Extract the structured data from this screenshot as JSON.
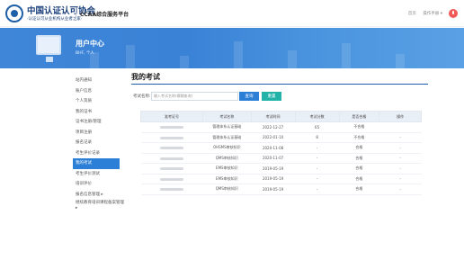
{
  "header": {
    "org_name": "中国认证认可协会",
    "org_subtitle": "·认证认可从业机构从业者之家·",
    "platform_title": "CCAA综合服务平台",
    "links": [
      "首页",
      "操作手册 ▾"
    ]
  },
  "banner": {
    "title": "用户中心",
    "user_line": "BHF, 个人"
  },
  "sidebar": {
    "items": [
      {
        "label": "站内通知"
      },
      {
        "label": "账户信息"
      },
      {
        "label": "个人资质"
      },
      {
        "label": "我的证书"
      },
      {
        "label": "证书注册/管理"
      },
      {
        "label": "项目注册"
      },
      {
        "label": "报名记录"
      },
      {
        "label": "考生评价记录"
      },
      {
        "label": "我的考试",
        "active": true
      },
      {
        "label": "考生评价测试"
      },
      {
        "label": "培训评价"
      },
      {
        "label": "报名信息管理 ▸"
      },
      {
        "label": "继续教育培训课程备案管理 ▸"
      }
    ]
  },
  "main": {
    "title": "我的考试",
    "search_label": "考试名称:",
    "search_placeholder": "输入考试名称(模糊查询)",
    "query_btn": "查询",
    "reset_btn": "重置",
    "columns": [
      "准考证号",
      "考试名称",
      "考试时间",
      "考试分数",
      "是否合格",
      "操作"
    ],
    "rows": [
      {
        "name": "管理体系认证基础",
        "time": "2022-12-27",
        "score": "65",
        "pass": "不合格",
        "op": ""
      },
      {
        "name": "管理体系认证基础",
        "time": "2022-01-10",
        "score": "8",
        "pass": "不合格",
        "op": "-"
      },
      {
        "name": "OHSMS审核知识",
        "time": "2020-11-08",
        "score": "-",
        "pass": "合格",
        "op": "-"
      },
      {
        "name": "QMS审核知识",
        "time": "2020-11-07",
        "score": "-",
        "pass": "合格",
        "op": "-"
      },
      {
        "name": "EMS审核知识",
        "time": "2019-05-19",
        "score": "-",
        "pass": "合格",
        "op": "-"
      },
      {
        "name": "EMS审核知识",
        "time": "2019-05-19",
        "score": "-",
        "pass": "合格",
        "op": "-"
      },
      {
        "name": "QMS审核知识",
        "time": "2019-05-19",
        "score": "-",
        "pass": "合格",
        "op": "-"
      }
    ]
  },
  "colors": {
    "accent": "#2b7fd6",
    "reset": "#22b3a8",
    "banner": "#3f86d8",
    "power": "#f25a5a"
  }
}
